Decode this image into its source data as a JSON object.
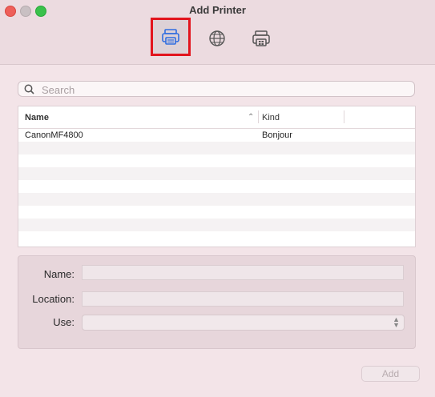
{
  "window": {
    "title": "Add Printer"
  },
  "toolbar": {
    "tabs": [
      {
        "icon": "default-printer-icon",
        "selected": true
      },
      {
        "icon": "ip-globe-icon",
        "selected": false
      },
      {
        "icon": "windows-printer-icon",
        "selected": false
      }
    ]
  },
  "search": {
    "placeholder": "Search",
    "value": ""
  },
  "printer_list": {
    "columns": [
      "Name",
      "Kind"
    ],
    "sorted_column": "Name",
    "rows": [
      {
        "name": "CanonMF4800",
        "kind": "Bonjour"
      },
      {
        "name": "",
        "kind": ""
      },
      {
        "name": "",
        "kind": ""
      },
      {
        "name": "",
        "kind": ""
      },
      {
        "name": "",
        "kind": ""
      },
      {
        "name": "",
        "kind": ""
      },
      {
        "name": "",
        "kind": ""
      },
      {
        "name": "",
        "kind": ""
      },
      {
        "name": "",
        "kind": ""
      }
    ]
  },
  "form": {
    "name_label": "Name:",
    "location_label": "Location:",
    "use_label": "Use:",
    "name_value": "",
    "location_value": "",
    "use_value": ""
  },
  "actions": {
    "add_label": "Add"
  },
  "colors": {
    "accent": "#2f6de0",
    "highlight_border": "#e2141d",
    "close": "#ee5f5a",
    "maximize": "#3ac14b"
  }
}
